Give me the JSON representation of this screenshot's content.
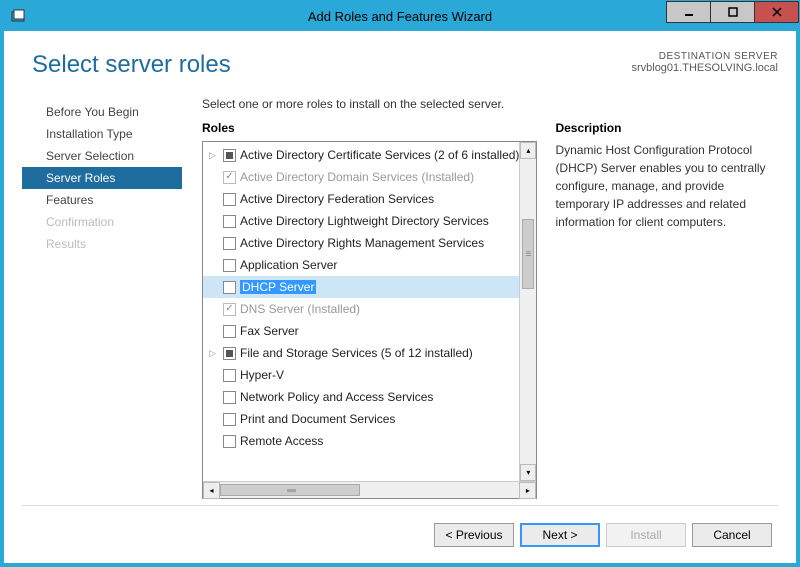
{
  "window": {
    "title": "Add Roles and Features Wizard"
  },
  "page": {
    "title": "Select server roles",
    "destination_label": "DESTINATION SERVER",
    "destination_value": "srvblog01.THESOLVING.local",
    "prompt": "Select one or more roles to install on the selected server."
  },
  "nav": [
    {
      "label": "Before You Begin"
    },
    {
      "label": "Installation Type"
    },
    {
      "label": "Server Selection"
    },
    {
      "label": "Server Roles",
      "selected": true
    },
    {
      "label": "Features"
    },
    {
      "label": "Confirmation",
      "disabled": true
    },
    {
      "label": "Results",
      "disabled": true
    }
  ],
  "roles": {
    "heading": "Roles",
    "items": [
      {
        "label": "Active Directory Certificate Services (2 of 6 installed)",
        "state": "tri",
        "expandable": true
      },
      {
        "label": "Active Directory Domain Services (Installed)",
        "state": "checked",
        "installed": true
      },
      {
        "label": "Active Directory Federation Services",
        "state": "unchecked"
      },
      {
        "label": "Active Directory Lightweight Directory Services",
        "state": "unchecked"
      },
      {
        "label": "Active Directory Rights Management Services",
        "state": "unchecked"
      },
      {
        "label": "Application Server",
        "state": "unchecked"
      },
      {
        "label": "DHCP Server",
        "state": "unchecked",
        "selected": true
      },
      {
        "label": "DNS Server (Installed)",
        "state": "checked",
        "installed": true
      },
      {
        "label": "Fax Server",
        "state": "unchecked"
      },
      {
        "label": "File and Storage Services (5 of 12 installed)",
        "state": "tri",
        "expandable": true
      },
      {
        "label": "Hyper-V",
        "state": "unchecked"
      },
      {
        "label": "Network Policy and Access Services",
        "state": "unchecked"
      },
      {
        "label": "Print and Document Services",
        "state": "unchecked"
      },
      {
        "label": "Remote Access",
        "state": "unchecked"
      }
    ]
  },
  "description": {
    "heading": "Description",
    "text": "Dynamic Host Configuration Protocol (DHCP) Server enables you to centrally configure, manage, and provide temporary IP addresses and related information for client computers."
  },
  "footer": {
    "previous": "< Previous",
    "next": "Next >",
    "install": "Install",
    "cancel": "Cancel"
  }
}
